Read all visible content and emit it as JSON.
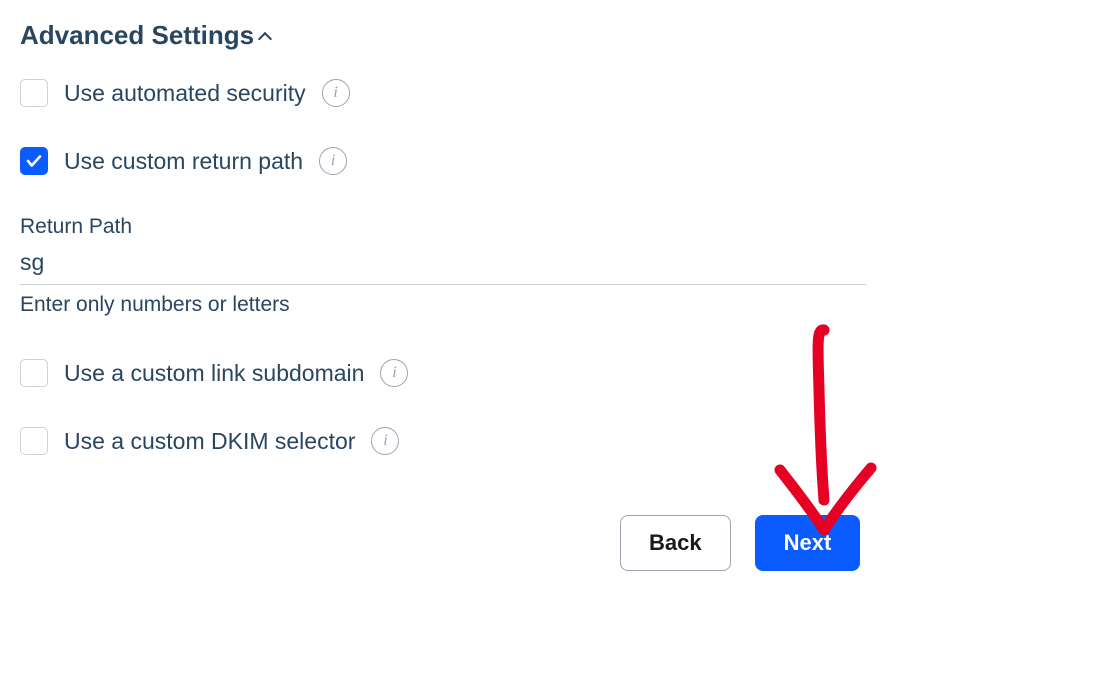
{
  "header": {
    "title": "Advanced Settings"
  },
  "options": {
    "automated_security": {
      "label": "Use automated security",
      "checked": false
    },
    "custom_return_path": {
      "label": "Use custom return path",
      "checked": true
    },
    "custom_link_subdomain": {
      "label": "Use a custom link subdomain",
      "checked": false
    },
    "custom_dkim_selector": {
      "label": "Use a custom DKIM selector",
      "checked": false
    }
  },
  "return_path": {
    "label": "Return Path",
    "value": "sg",
    "help": "Enter only numbers or letters"
  },
  "buttons": {
    "back": "Back",
    "next": "Next"
  },
  "colors": {
    "primary": "#0b5cff",
    "text": "#294661",
    "annotation": "#e60023"
  }
}
